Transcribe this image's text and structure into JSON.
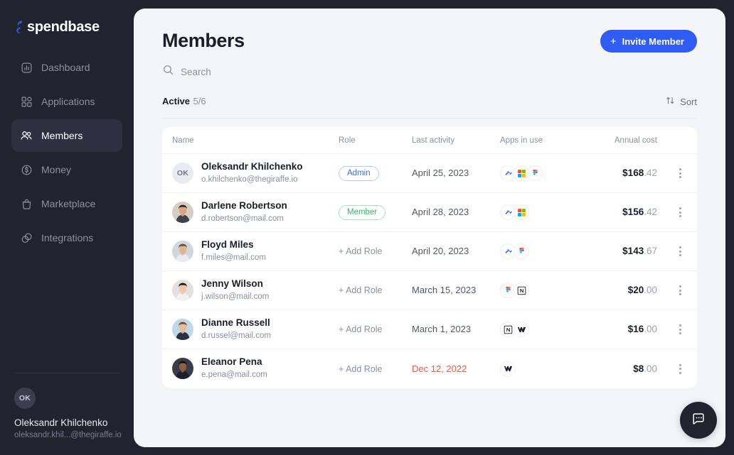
{
  "brand": {
    "name": "spendbase",
    "logo_icon": "spendbase-logo-icon",
    "accent": "#2f5cf4"
  },
  "sidebar": {
    "items": [
      {
        "label": "Dashboard",
        "icon": "chart-bar-icon",
        "active": false
      },
      {
        "label": "Applications",
        "icon": "grid-squares-icon",
        "active": false
      },
      {
        "label": "Members",
        "icon": "users-icon",
        "active": true
      },
      {
        "label": "Money",
        "icon": "dollar-circle-icon",
        "active": false
      },
      {
        "label": "Marketplace",
        "icon": "shopping-bag-icon",
        "active": false
      },
      {
        "label": "Integrations",
        "icon": "overlap-circles-icon",
        "active": false
      }
    ],
    "user": {
      "initials": "OK",
      "name": "Oleksandr Khilchenko",
      "email": "oleksandr.khil...@thegiraffe.io"
    }
  },
  "header": {
    "title": "Members",
    "invite_button": {
      "label": "Invite Member",
      "icon": "plus-icon"
    }
  },
  "search": {
    "placeholder": "Search",
    "value": "",
    "icon": "search-icon"
  },
  "subheader": {
    "active_label": "Active",
    "active_count": "5/6",
    "sort_label": "Sort",
    "sort_icon": "sort-arrows-icon"
  },
  "table": {
    "columns": [
      "Name",
      "Role",
      "Last activity",
      "Apps in use",
      "Annual cost"
    ],
    "rows": [
      {
        "avatar_type": "initials",
        "initials": "OK",
        "name": "Oleksandr Khilchenko",
        "email": "o.khilchenko@thegiraffe.io",
        "role": "Admin",
        "role_type": "admin",
        "last_activity": "April 25, 2023",
        "activity_overdue": false,
        "apps": [
          "zoom-icon",
          "microsoft-icon",
          "figma-icon"
        ],
        "cost_whole": "$168",
        "cost_decimal": ".42"
      },
      {
        "avatar_type": "photo",
        "photo_id": "darlene",
        "name": "Darlene Robertson",
        "email": "d.robertson@mail.com",
        "role": "Member",
        "role_type": "member",
        "last_activity": "April 28, 2023",
        "activity_overdue": false,
        "apps": [
          "zoom-icon",
          "microsoft-icon"
        ],
        "cost_whole": "$156",
        "cost_decimal": ".42"
      },
      {
        "avatar_type": "photo",
        "photo_id": "floyd",
        "name": "Floyd Miles",
        "email": "f.miles@mail.com",
        "role": "+ Add Role",
        "role_type": "add",
        "last_activity": "April 20, 2023",
        "activity_overdue": false,
        "apps": [
          "zoom-icon",
          "figma-icon"
        ],
        "cost_whole": "$143",
        "cost_decimal": ".67"
      },
      {
        "avatar_type": "photo",
        "photo_id": "jenny",
        "name": "Jenny Wilson",
        "email": "j.wilson@mail.com",
        "role": "+ Add Role",
        "role_type": "add",
        "last_activity": "March 15, 2023",
        "activity_overdue": false,
        "apps": [
          "figma-icon",
          "notion-icon"
        ],
        "cost_whole": "$20",
        "cost_decimal": ".00"
      },
      {
        "avatar_type": "photo",
        "photo_id": "dianne",
        "name": "Dianne Russell",
        "email": "d.russel@mail.com",
        "role": "+ Add Role",
        "role_type": "add",
        "last_activity": "March 1, 2023",
        "activity_overdue": false,
        "apps": [
          "notion-icon",
          "webflow-icon"
        ],
        "cost_whole": "$16",
        "cost_decimal": ".00"
      },
      {
        "avatar_type": "photo",
        "photo_id": "eleanor",
        "name": "Eleanor Pena",
        "email": "e.pena@mail.com",
        "role": "+ Add Role",
        "role_type": "add",
        "last_activity": "Dec 12, 2022",
        "activity_overdue": true,
        "apps": [
          "webflow-icon"
        ],
        "cost_whole": "$8",
        "cost_decimal": ".00"
      }
    ],
    "row_menu_icon": "kebab-menu-icon"
  },
  "chat_widget": {
    "icon": "chat-bubble-icon"
  },
  "colors": {
    "sidebar_bg": "#21242f",
    "panel_bg": "#f4f5f8",
    "accent_blue": "#2f5cf4",
    "badge_member_green": "#35b768",
    "overdue_red": "#f2593f"
  }
}
